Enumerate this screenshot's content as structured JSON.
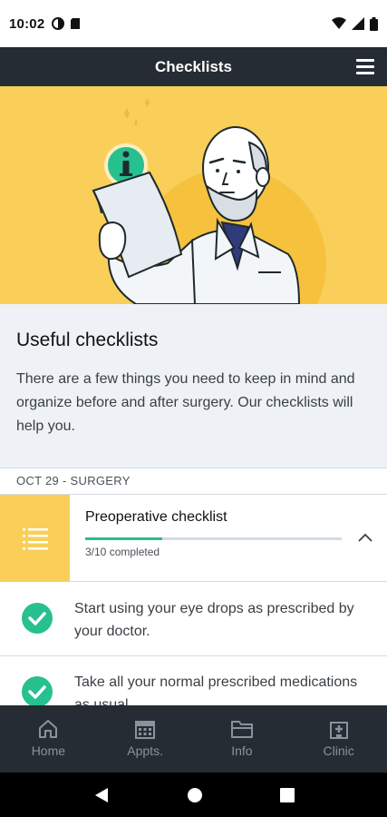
{
  "status_bar": {
    "time": "10:02",
    "icons": [
      "circle-half-icon",
      "sim-card-icon",
      "wifi-icon",
      "signal-icon",
      "battery-icon"
    ]
  },
  "app_bar": {
    "title": "Checklists",
    "menu_icon": "hamburger-menu-icon"
  },
  "hero": {
    "illustration": "doctor-reading-document",
    "info_icon": "info-icon",
    "colors": {
      "background": "#f9cf5a",
      "circle": "#f6c23e",
      "badge": "#27c08f"
    }
  },
  "intro": {
    "title": "Useful checklists",
    "body": "There are a few things you need to keep in mind and organize before and after surgery. Our checklists will help you."
  },
  "section": {
    "label": "OCT 29 - SURGERY"
  },
  "checklist": {
    "title": "Preoperative checklist",
    "progress_text": "3/10 completed",
    "progress_fraction": 0.3,
    "icon": "list-icon",
    "toggle_icon": "chevron-up-icon"
  },
  "tasks": [
    {
      "text": "Start using your eye drops as prescribed by your doctor.",
      "done": true
    },
    {
      "text": "Take all your normal prescribed medications as usual.",
      "done": true
    }
  ],
  "bottom_nav": [
    {
      "label": "Home",
      "icon": "home-icon"
    },
    {
      "label": "Appts.",
      "icon": "calendar-icon"
    },
    {
      "label": "Info",
      "icon": "folder-icon"
    },
    {
      "label": "Clinic",
      "icon": "clinic-icon"
    }
  ],
  "system_nav": [
    "back-icon",
    "home-circle-icon",
    "recents-icon"
  ],
  "colors": {
    "accent_yellow": "#f9cf5a",
    "accent_green": "#27c08f",
    "dark_bar": "#262c33",
    "nav_inactive": "#8a929b"
  }
}
